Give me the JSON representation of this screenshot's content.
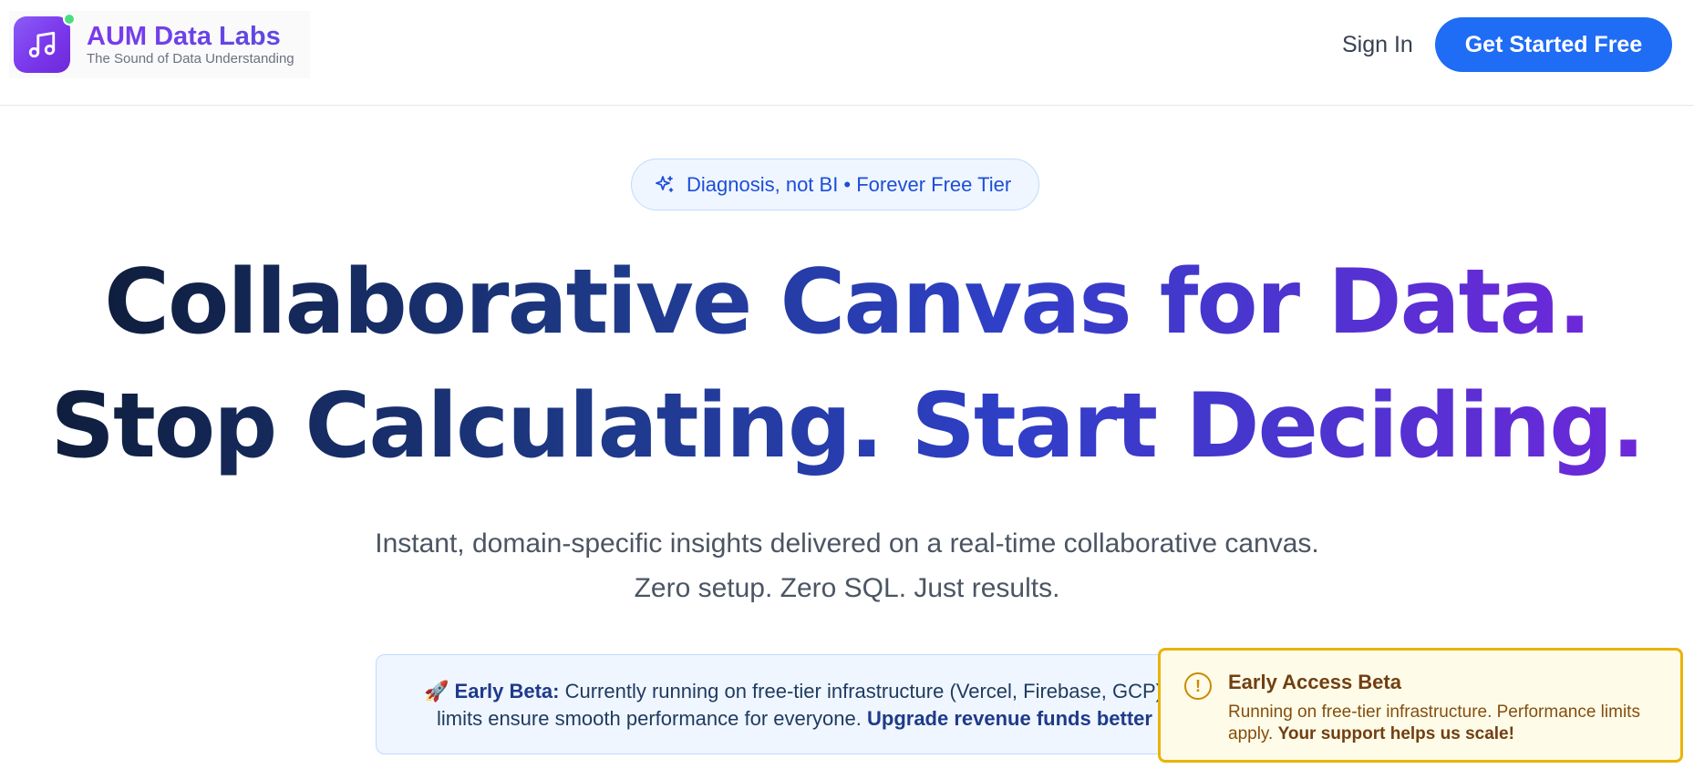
{
  "header": {
    "brand_name": "AUM Data Labs",
    "brand_tagline": "The Sound of Data Understanding",
    "logo_icon": "music-note-icon",
    "signin_label": "Sign In",
    "cta_label": "Get Started Free"
  },
  "hero": {
    "pill_icon": "sparkles-icon",
    "pill_text": "Diagnosis, not BI • Forever Free Tier",
    "headline_line1": "Collaborative Canvas for Data.",
    "headline_line2": "Stop Calculating. Start Deciding.",
    "subtitle_line1": "Instant, domain-specific insights delivered on a real-time collaborative canvas.",
    "subtitle_line2": "Zero setup. Zero SQL. Just results."
  },
  "beta_banner": {
    "emoji": "🚀",
    "label": "Early Beta:",
    "text_line1": "Currently running on free-tier infrastructure (Vercel, Firebase, GCP).",
    "text_line2_plain": "limits ensure smooth performance for everyone.",
    "text_line2_bold": "Upgrade revenue funds better"
  },
  "toast": {
    "icon": "alert-circle-icon",
    "title": "Early Access Beta",
    "body_plain": "Running on free-tier infrastructure. Performance limits apply.",
    "body_bold": "Your support helps us scale!"
  },
  "colors": {
    "brand_purple": "#7c3aed",
    "cta_blue": "#1f6cf5",
    "warning_yellow": "#eab308",
    "info_bg": "#eff6ff"
  }
}
